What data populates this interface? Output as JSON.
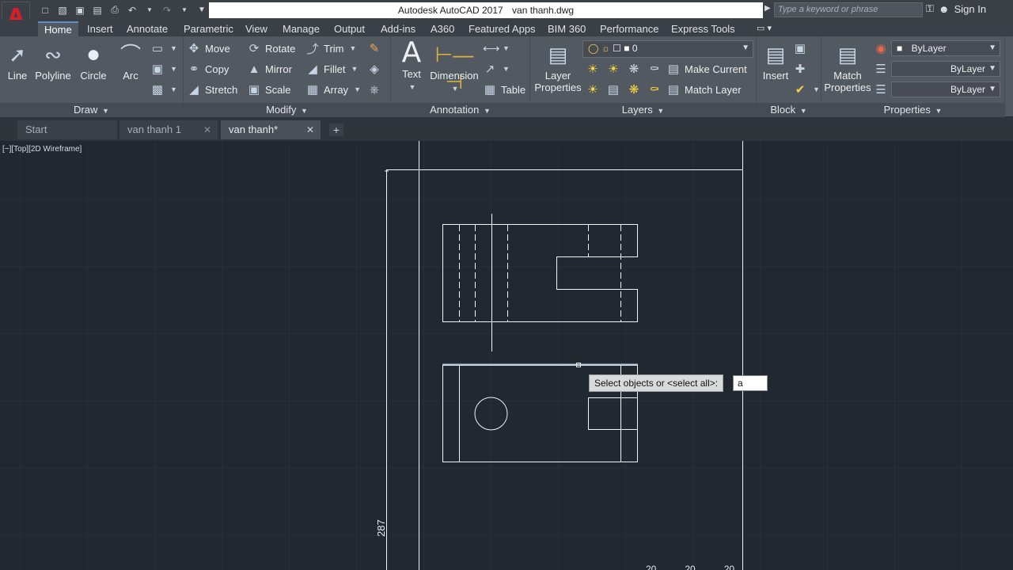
{
  "titlebar": {
    "app_name": "Autodesk AutoCAD 2017",
    "file_name": "van thanh.dwg",
    "search_placeholder": "Type a keyword or phrase",
    "sign_in": "Sign In",
    "logo_letter": "A"
  },
  "ribbon_tabs": [
    "Home",
    "Insert",
    "Annotate",
    "Parametric",
    "View",
    "Manage",
    "Output",
    "Add-ins",
    "A360",
    "Featured Apps",
    "BIM 360",
    "Performance",
    "Express Tools"
  ],
  "draw": {
    "title": "Draw",
    "line": "Line",
    "polyline": "Polyline",
    "circle": "Circle",
    "arc": "Arc"
  },
  "modify": {
    "title": "Modify",
    "move": "Move",
    "rotate": "Rotate",
    "trim": "Trim",
    "copy": "Copy",
    "mirror": "Mirror",
    "fillet": "Fillet",
    "stretch": "Stretch",
    "scale": "Scale",
    "array": "Array"
  },
  "annotation": {
    "title": "Annotation",
    "text": "Text",
    "dimension": "Dimension",
    "table": "Table"
  },
  "layers": {
    "title": "Layers",
    "layer_properties_1": "Layer",
    "layer_properties_2": "Properties",
    "current_layer": "0",
    "make_current": "Make Current",
    "match_layer": "Match Layer"
  },
  "block": {
    "title": "Block",
    "insert": "Insert"
  },
  "properties": {
    "title": "Properties",
    "match_1": "Match",
    "match_2": "Properties",
    "color": "ByLayer",
    "linetype": "ByLayer",
    "lineweight": "ByLayer"
  },
  "file_tabs": {
    "start": "Start",
    "tab1": "van thanh 1",
    "tab2": "van thanh*"
  },
  "viewport": {
    "label": "[−][Top][2D Wireframe]",
    "prompt": "Select objects or <select all>:",
    "input_value": "a",
    "dimension_value": "287",
    "bottom_numbers": [
      "20",
      "20",
      "20"
    ]
  },
  "colors": {
    "background": "#212830",
    "ribbon": "#535961",
    "accent": "#5d8cc6"
  }
}
